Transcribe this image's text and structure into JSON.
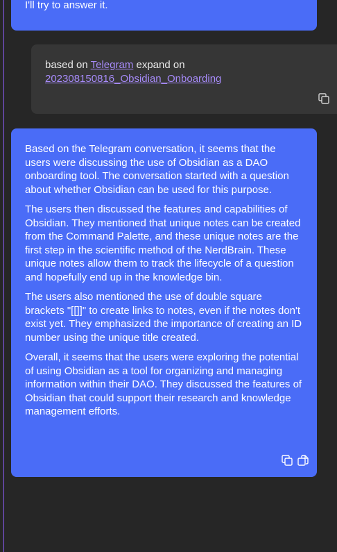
{
  "messages": {
    "ai_top": {
      "text": "I'll try to answer it."
    },
    "user": {
      "prefix": "based on ",
      "link1": "Telegram",
      "middle": " expand on ",
      "link2": "202308150816_Obsidian_Onboarding"
    },
    "ai_main": {
      "paragraphs": [
        "Based on the Telegram conversation, it seems that the users were discussing the use of Obsidian as a DAO onboarding tool. The conversation started with a question about whether Obsidian can be used for this purpose.",
        "The users then discussed the features and capabilities of Obsidian. They mentioned that unique notes can be created from the Command Palette, and these unique notes are the first step in the scientific method of the NerdBrain. These unique notes allow them to track the lifecycle of a question and hopefully end up in the knowledge bin.",
        "The users also mentioned the use of double square brackets \"[[]]\" to create links to notes, even if the notes don't exist yet. They emphasized the importance of creating an ID number using the unique title created.",
        "Overall, it seems that the users were exploring the potential of using Obsidian as a tool for organizing and managing information within their DAO. They discussed the features of Obsidian that could support their research and knowledge management efforts."
      ]
    }
  },
  "icons": {
    "copy": "copy-icon",
    "copy_to_note": "copy-to-note-icon"
  },
  "colors": {
    "background": "#262626",
    "ai_bubble": "#4a6cf7",
    "user_bubble": "#363636",
    "link": "#a78bfa",
    "accent_border": "#8b5cf6"
  }
}
